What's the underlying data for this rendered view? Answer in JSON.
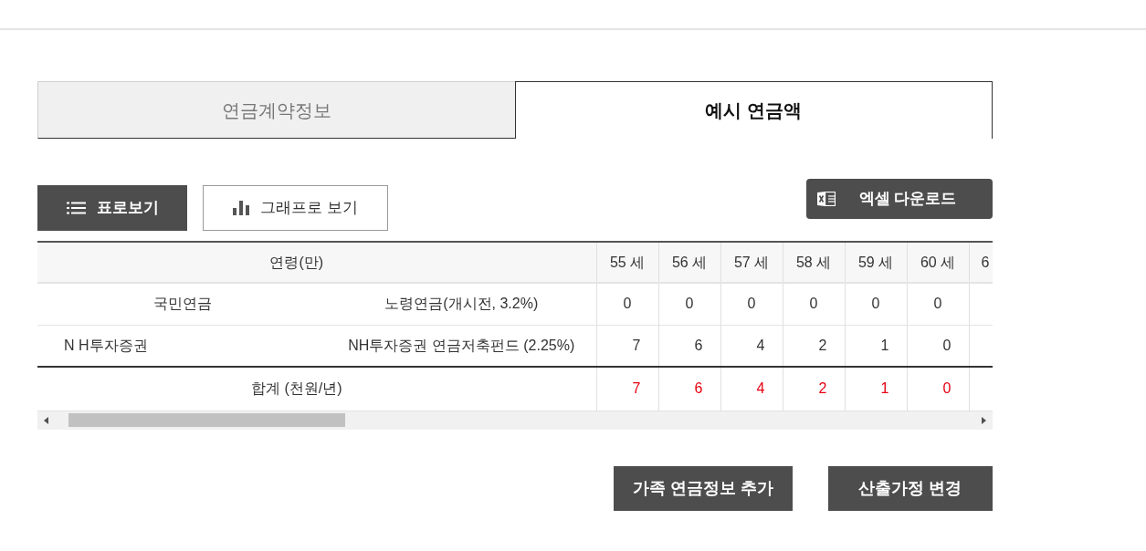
{
  "tabs": [
    {
      "label": "연금계약정보",
      "selected": false
    },
    {
      "label": "예시 연금액",
      "selected": true
    }
  ],
  "view_toggle": [
    {
      "kind": "list",
      "label": "표로보기",
      "selected": true
    },
    {
      "kind": "chart",
      "label": "그래프로 보기",
      "selected": false
    }
  ],
  "excel_button": {
    "label": "엑셀 다운로드"
  },
  "table": {
    "age_header": "연령(만)",
    "columns": [
      "55 세",
      "56 세",
      "57 세",
      "58 세",
      "59 세",
      "60 세",
      "6"
    ],
    "rows": [
      {
        "kind": "centered",
        "provider": "국민연금",
        "product": "노령연금(개시전, 3.2%)",
        "values": [
          "0",
          "0",
          "0",
          "0",
          "0",
          "0"
        ]
      },
      {
        "kind": "fund",
        "provider": "N H투자증권",
        "product": "NH투자증권 연금저축펀드 (2.25%)",
        "values": [
          "7",
          "6",
          "4",
          "2",
          "1",
          "0"
        ]
      }
    ],
    "total": {
      "label": "합계 (천원/년)",
      "values": [
        "7",
        "6",
        "4",
        "2",
        "1",
        "0"
      ]
    }
  },
  "actions": [
    "가족 연금정보 추가",
    "산출가정 변경"
  ]
}
